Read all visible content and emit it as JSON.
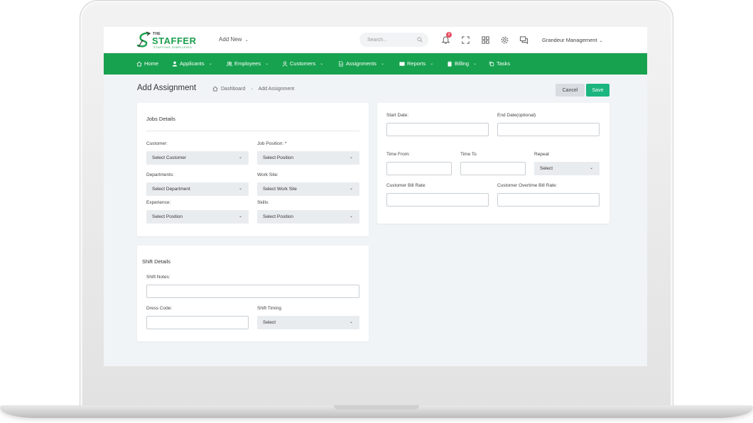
{
  "app": {
    "logo_the": "THE",
    "logo_name": "STAFFER",
    "logo_tagline": "STAFFING SIMPLIFIED",
    "add_new": "Add New",
    "search_placeholder": "Search...",
    "notification_count": "9",
    "user": "Grandeur Management",
    "brand_color": "#17a24f"
  },
  "nav": [
    {
      "label": "Home",
      "icon": "home-icon"
    },
    {
      "label": "Applicants",
      "icon": "user-icon"
    },
    {
      "label": "Employees",
      "icon": "users-icon"
    },
    {
      "label": "Customers",
      "icon": "user-outline-icon"
    },
    {
      "label": "Assignments",
      "icon": "document-icon"
    },
    {
      "label": "Reports",
      "icon": "book-icon"
    },
    {
      "label": "Billing",
      "icon": "clipboard-icon"
    },
    {
      "label": "Tasks",
      "icon": "copy-icon"
    }
  ],
  "page": {
    "title": "Add Assignment",
    "breadcrumb_home": "Dashboard",
    "breadcrumb_current": "Add Assignment",
    "cancel": "Cancel",
    "save": "Save"
  },
  "jobs": {
    "title": "Jobs Details",
    "customer_label": "Customer:",
    "customer_value": "Select Customer",
    "job_position_label": "Job Position: *",
    "job_position_value": "Select Position",
    "departments_label": "Departments:",
    "departments_value": "Select Department",
    "work_site_label": "Work Site:",
    "work_site_value": "Select Work Site",
    "experience_label": "Experience:",
    "experience_value": "Select Position",
    "skills_label": "Skills:",
    "skills_value": "Select Position"
  },
  "schedule": {
    "start_date_label": "Start Date:",
    "end_date_label": "End Date(optional)",
    "time_from_label": "Time From:",
    "time_to_label": "Time To",
    "repeat_label": "Repeat",
    "repeat_value": "Select",
    "bill_rate_label": "Customer Bill Rate:",
    "overtime_rate_label": "Customer Overtime Bill Rate:"
  },
  "shift": {
    "title": "Shift Details",
    "notes_label": "Shift Notes:",
    "dress_code_label": "Dress Code:",
    "timing_label": "Shift Timing",
    "timing_value": "Select"
  }
}
